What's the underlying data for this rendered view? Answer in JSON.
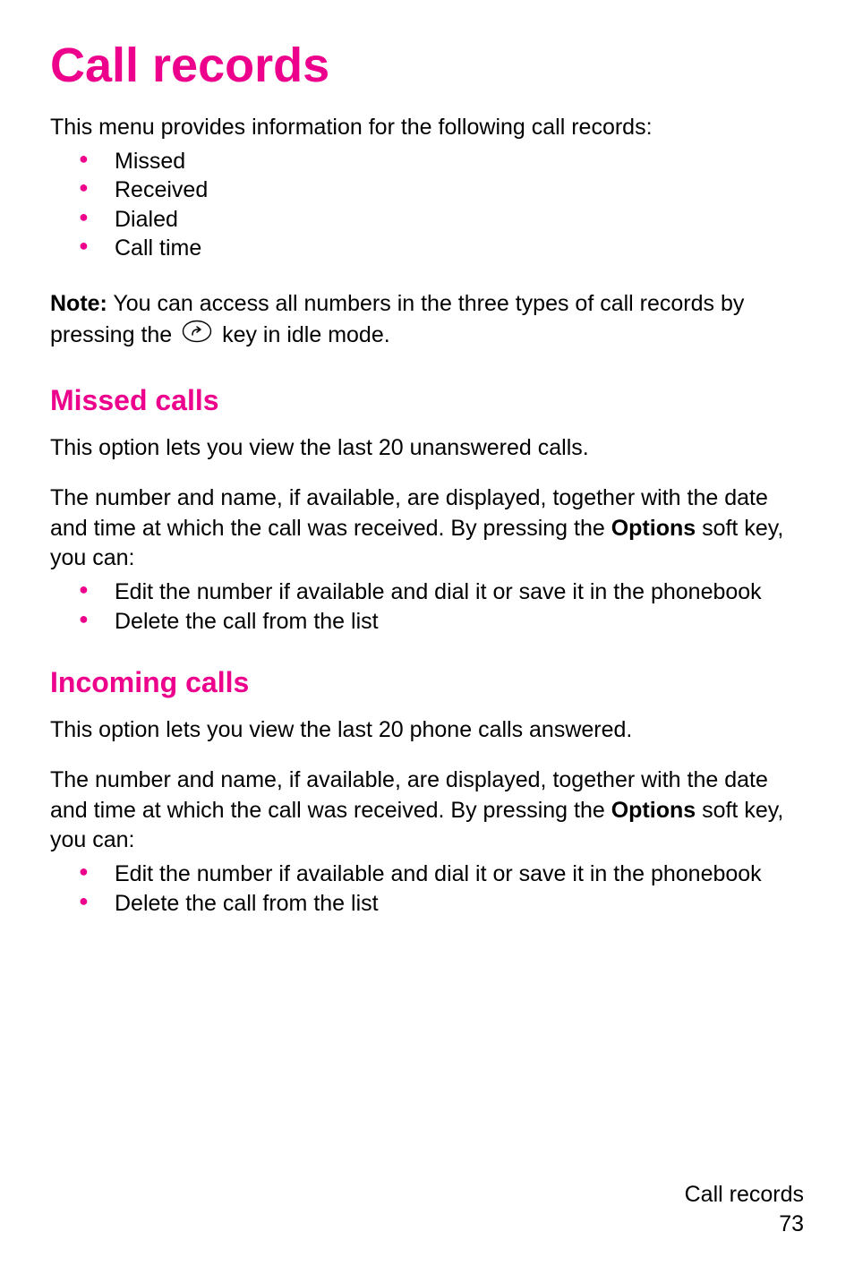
{
  "title": "Call records",
  "intro": "This menu provides information for the following call records:",
  "records_list": [
    "Missed",
    "Received",
    "Dialed",
    "Call time"
  ],
  "note": {
    "label": "Note:",
    "before_icon": " You can access all numbers in the three types of call records by pressing the ",
    "after_icon": " key in idle mode."
  },
  "sections": [
    {
      "heading": "Missed calls",
      "para1": "This option lets you view the last 20 unanswered calls.",
      "para2_pre": "The number and name, if available, are displayed, together with the date and time at which the call was received. By pressing the ",
      "para2_bold": "Options",
      "para2_post": " soft key, you can:",
      "bullets": [
        "Edit the number if available and dial it or save it in the phonebook",
        "Delete the call from the list"
      ]
    },
    {
      "heading": "Incoming calls",
      "para1": "This option lets you view the last 20 phone calls answered.",
      "para2_pre": "The number and name, if available, are displayed, together with the date and time at which the call was received. By pressing the ",
      "para2_bold": "Options",
      "para2_post": " soft key, you can:",
      "bullets": [
        "Edit the number if available and dial it or save it in the phonebook",
        "Delete the call from the list"
      ]
    }
  ],
  "footer": {
    "section_name": "Call records",
    "page_number": "73"
  }
}
